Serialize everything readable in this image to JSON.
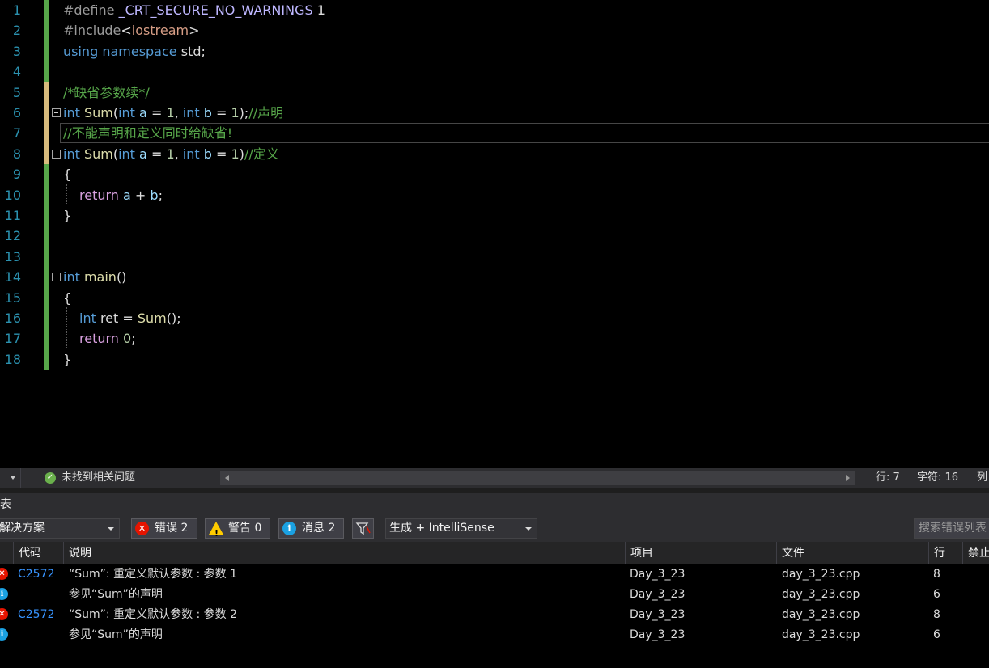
{
  "editor": {
    "line_numbers": [
      "1",
      "2",
      "3",
      "4",
      "5",
      "6",
      "7",
      "8",
      "9",
      "10",
      "11",
      "12",
      "13",
      "14",
      "15",
      "16",
      "17",
      "18"
    ],
    "line1": {
      "pp": "#define",
      "macro": "_CRT_SECURE_NO_WARNINGS",
      "rest": " 1"
    },
    "line2": {
      "pp": "#include",
      "lt": "<",
      "header": "iostream",
      "gt": ">"
    },
    "line3": {
      "kw1": "using",
      "kw2": "namespace",
      "rest": " std;"
    },
    "line5": {
      "comment": "/*缺省参数续*/"
    },
    "line6": {
      "kw_int": "int",
      "fn": "Sum",
      "open": "(",
      "int1": "int",
      "p1": "a",
      "eq1": " = ",
      "v1": "1",
      "sep": ", ",
      "int2": "int",
      "p2": "b",
      "eq2": " = ",
      "v2": "1",
      "close": ");",
      "comment": "//声明"
    },
    "line7": {
      "comment": "//不能声明和定义同时给缺省!"
    },
    "line8": {
      "kw_int": "int",
      "fn": "Sum",
      "open": "(",
      "int1": "int",
      "p1": "a",
      "eq1": " = ",
      "v1": "1",
      "sep": ", ",
      "int2": "int",
      "p2": "b",
      "eq2": " = ",
      "v2": "1",
      "close": ")",
      "comment": "//定义"
    },
    "line9": {
      "text": "{"
    },
    "line10": {
      "kw": "return",
      "p1": "a",
      "op": " + ",
      "p2": "b",
      "end": ";"
    },
    "line11": {
      "text": "}"
    },
    "line14": {
      "kw_int": "int",
      "fn": "main",
      "rest": "()"
    },
    "line15": {
      "text": "{"
    },
    "line16": {
      "kw_int": "int",
      "var": " ret = ",
      "fn": "Sum",
      "rest": "();"
    },
    "line17": {
      "kw": "return",
      "num": "0",
      "end": ";"
    },
    "line18": {
      "text": "}"
    }
  },
  "status": {
    "health": "未找到相关问题",
    "line": "行: 7",
    "char": "字符: 16",
    "col": "列"
  },
  "error_list": {
    "title": "表",
    "scope": "解决方案",
    "errors_label": "错误 2",
    "warnings_label": "警告 0",
    "messages_label": "消息 2",
    "source": "生成 + IntelliSense",
    "search_placeholder": "搜索错误列表",
    "columns": [
      "代码",
      "说明",
      "项目",
      "文件",
      "行",
      "禁止"
    ],
    "rows": [
      {
        "severity": "error",
        "code": "C2572",
        "description": "“Sum”: 重定义默认参数 : 参数 1",
        "project": "Day_3_23",
        "file": "day_3_23.cpp",
        "line": "8"
      },
      {
        "severity": "info",
        "code": "",
        "description": "参见“Sum”的声明",
        "project": "Day_3_23",
        "file": "day_3_23.cpp",
        "line": "6"
      },
      {
        "severity": "error",
        "code": "C2572",
        "description": "“Sum”: 重定义默认参数 : 参数 2",
        "project": "Day_3_23",
        "file": "day_3_23.cpp",
        "line": "8"
      },
      {
        "severity": "info",
        "code": "",
        "description": "参见“Sum”的声明",
        "project": "Day_3_23",
        "file": "day_3_23.cpp",
        "line": "6"
      }
    ]
  }
}
